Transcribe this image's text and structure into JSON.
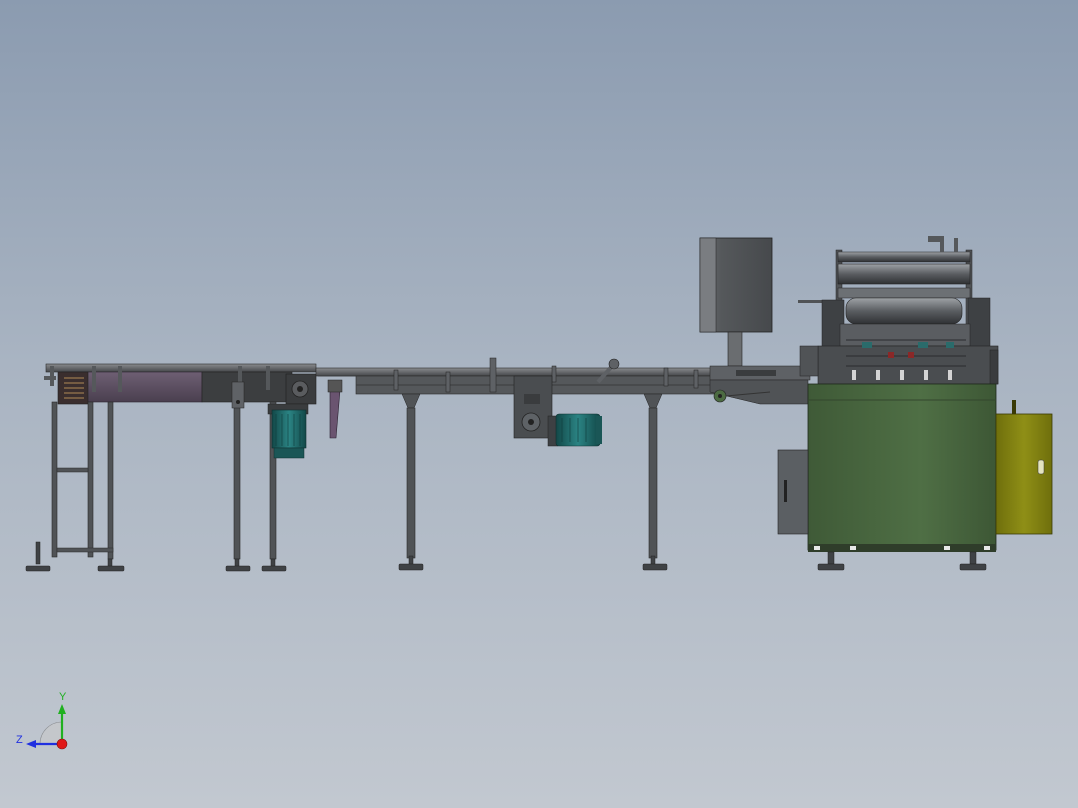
{
  "view": {
    "name": "cad-3d-viewport"
  },
  "colors": {
    "background_top": "#8b9bb0",
    "background_bottom": "#c2c8d0",
    "frame_steel": "#4e5052",
    "frame_dark": "#2e3032",
    "frame_light": "#7d8084",
    "conveyor_belt": "#5e4f63",
    "motor_teal": "#1f6b6b",
    "cabinet_green": "#4c6b42",
    "panel_yellow": "#8a8a12",
    "axis_x": "#e01818",
    "axis_y": "#20b020",
    "axis_z": "#2030e0"
  },
  "triad": {
    "y_label": "Y",
    "z_label": "Z"
  }
}
